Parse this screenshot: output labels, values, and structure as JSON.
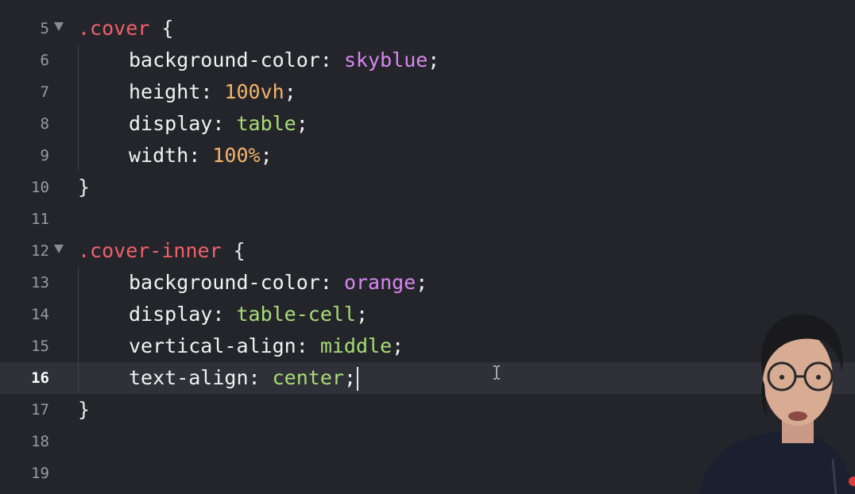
{
  "editor": {
    "language": "css",
    "current_line": 16,
    "lines": [
      {
        "num": "5",
        "fold": true,
        "indent": false,
        "tokens": [
          {
            "t": ".cover",
            "c": "sel"
          },
          {
            "t": " {",
            "c": "brace"
          }
        ]
      },
      {
        "num": "6",
        "fold": false,
        "indent": true,
        "tokens": [
          {
            "t": "background-color",
            "c": "prop"
          },
          {
            "t": ": ",
            "c": "punct"
          },
          {
            "t": "skyblue",
            "c": "kw"
          },
          {
            "t": ";",
            "c": "punct"
          }
        ]
      },
      {
        "num": "7",
        "fold": false,
        "indent": true,
        "tokens": [
          {
            "t": "height",
            "c": "prop"
          },
          {
            "t": ": ",
            "c": "punct"
          },
          {
            "t": "100vh",
            "c": "num"
          },
          {
            "t": ";",
            "c": "punct"
          }
        ]
      },
      {
        "num": "8",
        "fold": false,
        "indent": true,
        "tokens": [
          {
            "t": "display",
            "c": "prop"
          },
          {
            "t": ": ",
            "c": "punct"
          },
          {
            "t": "table",
            "c": "str"
          },
          {
            "t": ";",
            "c": "punct"
          }
        ]
      },
      {
        "num": "9",
        "fold": false,
        "indent": true,
        "tokens": [
          {
            "t": "width",
            "c": "prop"
          },
          {
            "t": ": ",
            "c": "punct"
          },
          {
            "t": "100%",
            "c": "num"
          },
          {
            "t": ";",
            "c": "punct"
          }
        ]
      },
      {
        "num": "10",
        "fold": false,
        "indent": false,
        "tokens": [
          {
            "t": "}",
            "c": "brace"
          }
        ]
      },
      {
        "num": "11",
        "fold": false,
        "indent": false,
        "tokens": []
      },
      {
        "num": "12",
        "fold": true,
        "indent": false,
        "tokens": [
          {
            "t": ".cover-inner",
            "c": "sel"
          },
          {
            "t": " {",
            "c": "brace"
          }
        ]
      },
      {
        "num": "13",
        "fold": false,
        "indent": true,
        "tokens": [
          {
            "t": "background-color",
            "c": "prop"
          },
          {
            "t": ": ",
            "c": "punct"
          },
          {
            "t": "orange",
            "c": "kw"
          },
          {
            "t": ";",
            "c": "punct"
          }
        ]
      },
      {
        "num": "14",
        "fold": false,
        "indent": true,
        "tokens": [
          {
            "t": "display",
            "c": "prop"
          },
          {
            "t": ": ",
            "c": "punct"
          },
          {
            "t": "table-cell",
            "c": "str"
          },
          {
            "t": ";",
            "c": "punct"
          }
        ]
      },
      {
        "num": "15",
        "fold": false,
        "indent": true,
        "tokens": [
          {
            "t": "vertical-align",
            "c": "prop"
          },
          {
            "t": ": ",
            "c": "punct"
          },
          {
            "t": "middle",
            "c": "str"
          },
          {
            "t": ";",
            "c": "punct"
          }
        ]
      },
      {
        "num": "16",
        "fold": false,
        "indent": true,
        "tokens": [
          {
            "t": "text-align",
            "c": "prop"
          },
          {
            "t": ": ",
            "c": "punct"
          },
          {
            "t": "center",
            "c": "str"
          },
          {
            "t": ";",
            "c": "punct"
          }
        ]
      },
      {
        "num": "17",
        "fold": false,
        "indent": false,
        "tokens": [
          {
            "t": "}",
            "c": "brace"
          }
        ]
      },
      {
        "num": "18",
        "fold": false,
        "indent": false,
        "tokens": []
      },
      {
        "num": "19",
        "fold": false,
        "indent": false,
        "tokens": []
      }
    ]
  },
  "colors": {
    "background": "#24252b",
    "current_line": "#2f3038",
    "selector": "#f0606a",
    "keyword": "#d887f0",
    "number": "#f3b36b",
    "string": "#a9dc76"
  }
}
